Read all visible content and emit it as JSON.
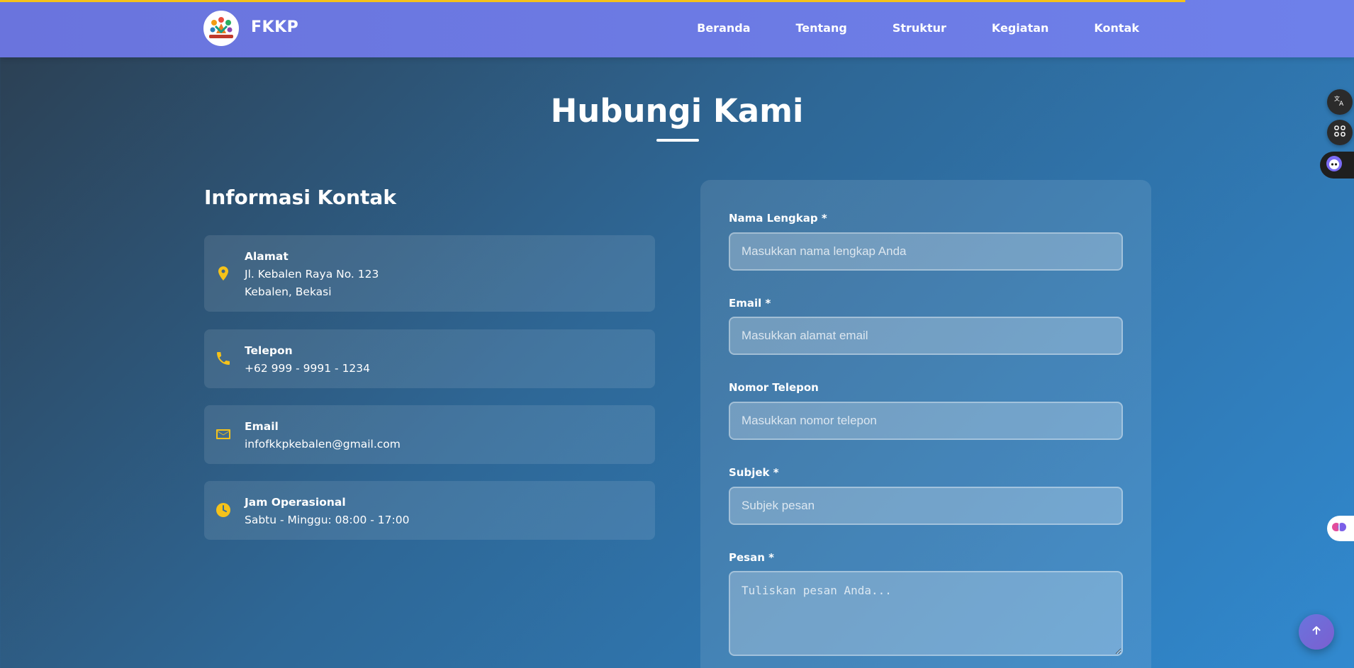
{
  "navbar": {
    "brand": "FKKP",
    "logo_icon": "fkkp-logo",
    "links": [
      "Beranda",
      "Tentang",
      "Struktur",
      "Kegiatan",
      "Kontak"
    ]
  },
  "section": {
    "title": "Hubungi Kami"
  },
  "contact_info": {
    "heading": "Informasi Kontak",
    "accent_color": "#f5c21a",
    "items": [
      {
        "icon": "map-pin-icon",
        "label": "Alamat",
        "lines": [
          "Jl. Kebalen Raya No. 123",
          "Kebalen, Bekasi"
        ]
      },
      {
        "icon": "phone-icon",
        "label": "Telepon",
        "lines": [
          "+62 999 - 9991 - 1234"
        ]
      },
      {
        "icon": "envelope-icon",
        "label": "Email",
        "lines": [
          "infofkkpkebalen@gmail.com"
        ]
      },
      {
        "icon": "clock-icon",
        "label": "Jam Operasional",
        "lines": [
          "Sabtu - Minggu: 08:00 - 17:00"
        ]
      }
    ]
  },
  "form": {
    "fields": [
      {
        "label": "Nama Lengkap *",
        "placeholder": "Masukkan nama lengkap Anda",
        "value": ""
      },
      {
        "label": "Email *",
        "placeholder": "Masukkan alamat email",
        "value": ""
      },
      {
        "label": "Nomor Telepon",
        "placeholder": "Masukkan nomor telepon",
        "value": ""
      },
      {
        "label": "Subjek *",
        "placeholder": "Subjek pesan",
        "value": ""
      },
      {
        "label": "Pesan *",
        "placeholder": "Tuliskan pesan Anda...",
        "value": ""
      }
    ]
  },
  "widgets": {
    "translate_icon": "translate-icon",
    "apps_icon": "apps-grid-icon",
    "assistant_icon": "assistant-bot-icon",
    "brain_icon": "brain-icon",
    "scroll_top_icon": "arrow-up-icon"
  },
  "colors": {
    "nav_bg": "#6a74dd",
    "progress": "#f5c21a",
    "page_gradient_start": "#2c3e50",
    "page_gradient_end": "#3189cf"
  }
}
